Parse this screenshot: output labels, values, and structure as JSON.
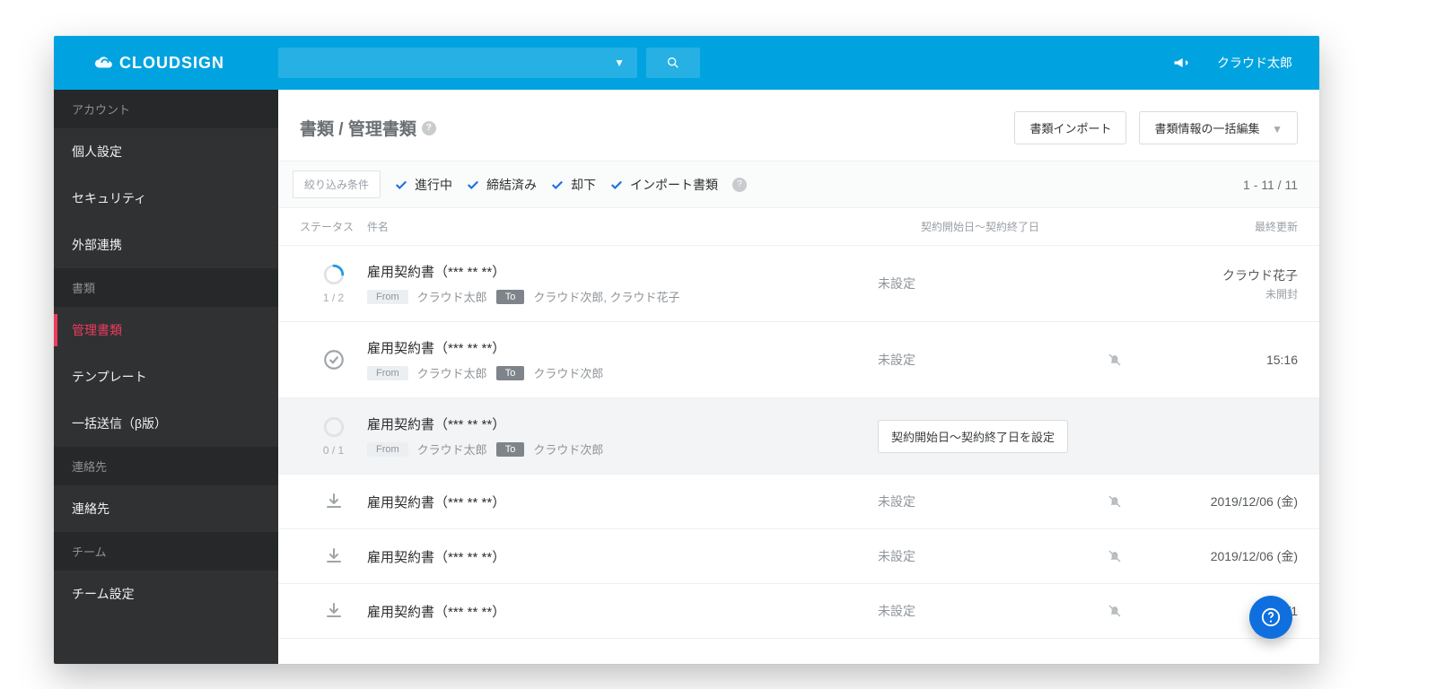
{
  "brand": "CLOUDSIGN",
  "header": {
    "username": "クラウド太郎"
  },
  "sidebar": {
    "groups": [
      {
        "title": "アカウント",
        "items": [
          "個人設定",
          "セキュリティ",
          "外部連携"
        ]
      },
      {
        "title": "書類",
        "items": [
          "管理書類",
          "テンプレート",
          "一括送信（β版）"
        ]
      },
      {
        "title": "連絡先",
        "items": [
          "連絡先"
        ]
      },
      {
        "title": "チーム",
        "items": [
          "チーム設定"
        ]
      }
    ],
    "active": "管理書類"
  },
  "breadcrumb": {
    "title": "書類 / 管理書類"
  },
  "actions": {
    "import_btn": "書類インポート",
    "bulk_btn": "書類情報の一括編集"
  },
  "filter": {
    "label": "絞り込み条件",
    "checks": [
      "進行中",
      "締結済み",
      "却下",
      "インポート書類"
    ],
    "count": "1 - 11 / 11"
  },
  "columns": {
    "status": "ステータス",
    "name": "件名",
    "daterange": "契約開始日～契約終了日",
    "updated": "最終更新"
  },
  "rows": [
    {
      "kind": "progress",
      "progress": "1 / 2",
      "title": "雇用契約書（*** ** **）",
      "from": "クラウド太郎",
      "to": "クラウド次郎, クラウド花子",
      "date": "未設定",
      "mute": false,
      "updated": "クラウド花子",
      "updated_sub": "未開封"
    },
    {
      "kind": "done",
      "progress": "",
      "title": "雇用契約書（*** ** **）",
      "from": "クラウド太郎",
      "to": "クラウド次郎",
      "date": "未設定",
      "mute": true,
      "updated": "15:16",
      "updated_sub": ""
    },
    {
      "kind": "progress_dim",
      "progress": "0 / 1",
      "title": "雇用契約書（*** ** **）",
      "from": "クラウド太郎",
      "to": "クラウド次郎",
      "date_action": "契約開始日～契約終了日を設定",
      "mute": false,
      "updated": "",
      "updated_sub": "",
      "hover": true
    },
    {
      "kind": "import",
      "progress": "",
      "title": "雇用契約書（*** ** **）",
      "from": "",
      "to": "",
      "date": "未設定",
      "mute": true,
      "updated": "2019/12/06 (金)",
      "updated_sub": ""
    },
    {
      "kind": "import",
      "progress": "",
      "title": "雇用契約書（*** ** **）",
      "from": "",
      "to": "",
      "date": "未設定",
      "mute": true,
      "updated": "2019/12/06 (金)",
      "updated_sub": ""
    },
    {
      "kind": "import",
      "progress": "",
      "title": "雇用契約書（*** ** **）",
      "from": "",
      "to": "",
      "date": "未設定",
      "mute": true,
      "updated": "2019/1",
      "updated_sub": ""
    }
  ],
  "labels": {
    "from": "From",
    "to": "To"
  }
}
